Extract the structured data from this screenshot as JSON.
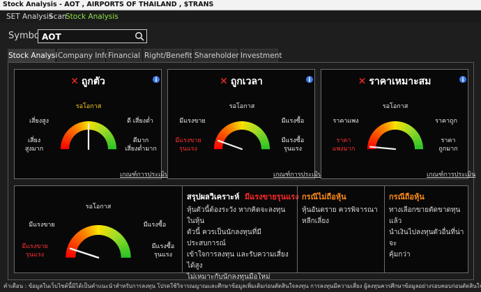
{
  "window": {
    "title": "Stock Analysis - AOT , AIRPORTS OF THAILAND , $TRANS"
  },
  "menu": [
    {
      "label": "SET Analysis",
      "active": false
    },
    {
      "label": "Scan",
      "active": false
    },
    {
      "label": "Stock Analysis",
      "active": true
    }
  ],
  "symbol": {
    "label": "Symbol",
    "value": "AOT",
    "icon": "search-icon"
  },
  "tabs": [
    "Stock Analysis",
    "Company Info",
    "Financial",
    "Right/Benefit",
    "Shareholder",
    "Investment"
  ],
  "gauges": [
    {
      "title": "ถูกตัว",
      "status_icon": "x-icon",
      "top": "รอโอกาส",
      "left_mid": "เสี่ยงสูง",
      "right_mid": "ดี เสี่ยงต่ำ",
      "left_low": "เสี่ยง\nสูงมาก",
      "right_low": "ดีมาก\nเสี่ยงต่ำมาก",
      "needle": 0.5,
      "top_color": "#ffd21f",
      "left_low_red": false,
      "criteria": "เกณฑ์การประเมิน"
    },
    {
      "title": "ถูกเวลา",
      "status_icon": "x-icon",
      "top": "รอโอกาส",
      "left_mid": "มีแรงขาย",
      "right_mid": "มีแรงซื้อ",
      "left_low": "มีแรงขาย\nรุนแรง",
      "right_low": "มีแรงซื้อ\nรุนแรง",
      "needle": 0.11,
      "top_color": "#e8e8e8",
      "left_low_red": true,
      "criteria": "เกณฑ์การประเมิน"
    },
    {
      "title": "ราคาเหมาะสม",
      "status_icon": "x-icon",
      "top": "รอโอกาส",
      "left_mid": "ราคาแพง",
      "right_mid": "ราคาถูก",
      "left_low": "ราคา\nแพงมาก",
      "right_low": "ราคา\nถูกมาก",
      "needle": 0.03,
      "top_color": "#e8e8e8",
      "left_low_red": true,
      "criteria": "เกณฑ์การประเมิน"
    }
  ],
  "summary_gauge": {
    "top": "รอโอกาส",
    "left_mid": "มีแรงขาย",
    "right_mid": "มีแรงซื้อ",
    "left_low": "มีแรงขาย\nรุนแรง",
    "right_low": "มีแรงซื้อ\nรุนแรง",
    "needle": 0.1
  },
  "summary": {
    "heading": "สรุปผลวิเคราะห์",
    "verdict": "มีแรงขายรุนแรง",
    "text": [
      "หุ้นตัวนี้ต้องระวัง หากคิดจะลงทุนในหุ้น",
      "ตัวนี้ ควรเป็นนักลงทุนที่มีประสบการณ์",
      "เข้าใจการลงทุน และรับความเสี่ยงได้สูง",
      "ไม่เหมาะกับนักลงทุนมือใหม่"
    ]
  },
  "no_stock": {
    "heading": "กรณีไม่ถือหุ้น",
    "text": [
      "หุ้นอันตราย ควรพิจารณา",
      "หลีกเลี่ยง"
    ]
  },
  "has_stock": {
    "heading": "กรณีถือหุ้น",
    "text": [
      "ทางเลือกขายตัดขาดทุน แล้ว",
      "นำเงินไปลงทุนตัวอื่นที่น่าจะ",
      "คุ้มกว่า"
    ]
  },
  "disclaimer": "คำเตือน : ข้อมูลในเว็บไซต์นี้มิได้เป็นคำแนะนำสำหรับการลงทุน โปรดใช้วิจารณญาณและศึกษาข้อมูลเพิ่มเติมก่อนตัดสินใจลงทุน การลงทุนมีความเสี่ยง ผู้ลงทุนควรศึกษาข้อมูลอย่างรอบคอบก่อนตัดสินใจลงทุน อ่านเพิ่มเติมใน",
  "colors": {
    "accent_green": "#8ee34a",
    "x_red": "#ff2a2a",
    "heading_orange": "#ff8c1a",
    "info_blue": "#3e7ce8"
  }
}
